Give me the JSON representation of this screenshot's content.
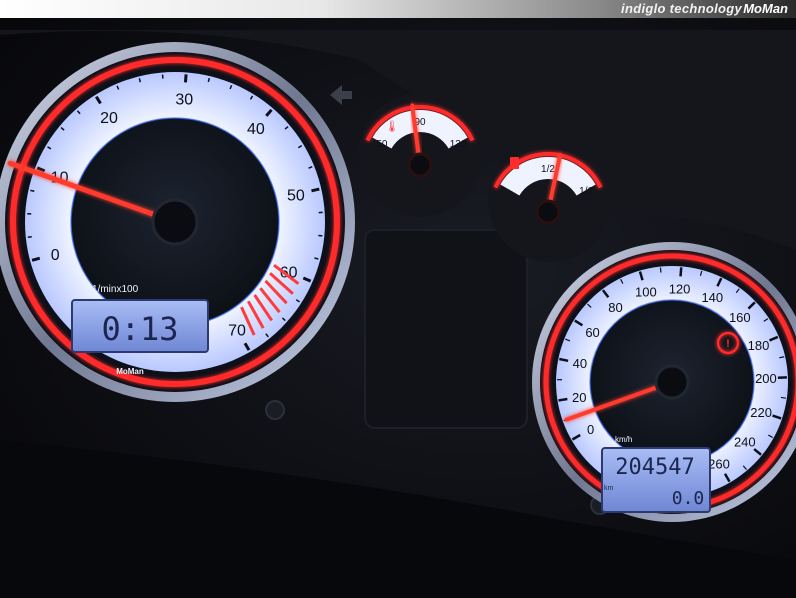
{
  "banner": {
    "text": "indiglo technology",
    "brand": "MoMan"
  },
  "tachometer": {
    "scale_labels": [
      "0",
      "10",
      "20",
      "30",
      "40",
      "50",
      "60",
      "70"
    ],
    "unit": "1/minx100",
    "brand": "MoMan",
    "display": "0:13",
    "needle_value": 9.5
  },
  "temperature_gauge": {
    "scale_labels": [
      "50",
      "90",
      "130"
    ],
    "needle_value": 85
  },
  "fuel_gauge": {
    "scale_labels": [
      "1/2",
      "1/1"
    ],
    "needle_value": 0.6
  },
  "speedometer": {
    "scale_labels": [
      "0",
      "20",
      "40",
      "60",
      "80",
      "100",
      "120",
      "140",
      "160",
      "180",
      "200",
      "220",
      "240",
      "260"
    ],
    "unit": "km/h",
    "odometer": "204547",
    "trip": "0.0",
    "trip_unit": "km",
    "needle_value": 10
  },
  "colors": {
    "backlight": "#eef3ff",
    "ring_red": "#ff2a2a",
    "needle": "#ff3b2f",
    "lcd": "#8aa2e8"
  }
}
